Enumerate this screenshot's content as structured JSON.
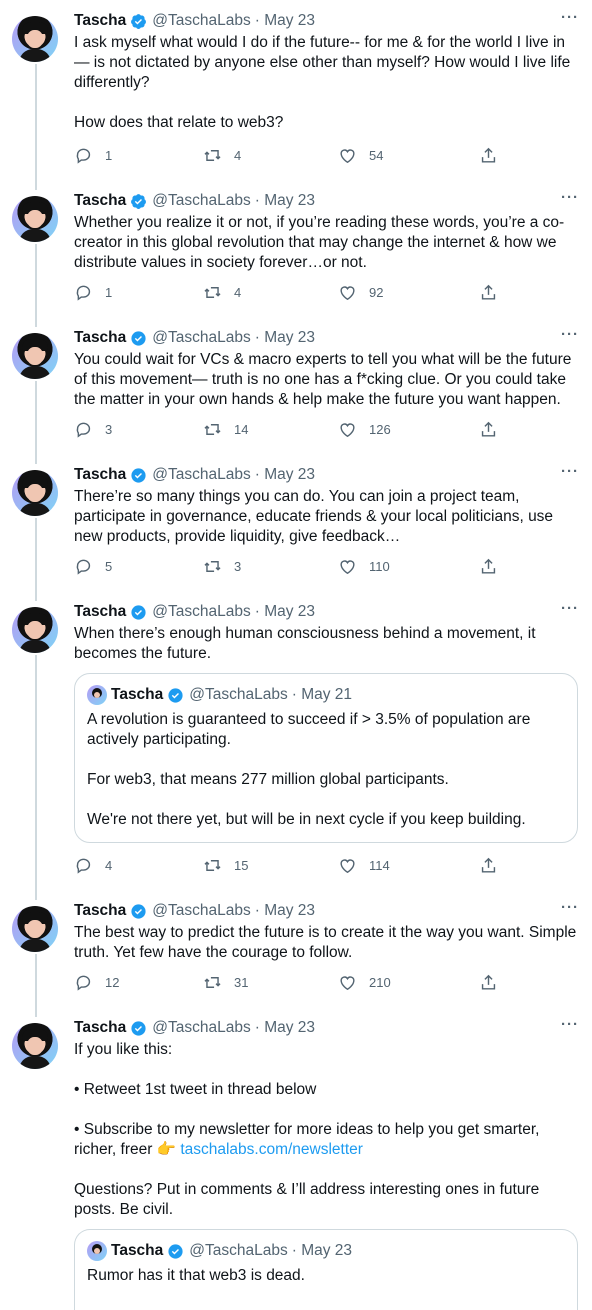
{
  "tweets": [
    {
      "name": "Tascha",
      "handle": "@TaschaLabs",
      "date": "· May 23",
      "text": "I ask myself what would I do if the future-- for me & for the world I live in— is not dictated by anyone else other than myself? How would I live life differently?\n\nHow does that relate to web3?",
      "replies": "1",
      "retweets": "4",
      "likes": "54"
    },
    {
      "name": "Tascha",
      "handle": "@TaschaLabs",
      "date": "· May 23",
      "text": "Whether you realize it or not, if you’re reading these words, you’re a co-creator in this global revolution that may change the internet & how we distribute values in society forever…or not.",
      "replies": "1",
      "retweets": "4",
      "likes": "92"
    },
    {
      "name": "Tascha",
      "handle": "@TaschaLabs",
      "date": "· May 23",
      "text": "You could wait for VCs & macro experts to tell you what will be the future of this movement— truth is no one has a f*cking clue. Or you could take the matter in your own hands & help make the future you want happen.",
      "replies": "3",
      "retweets": "14",
      "likes": "126"
    },
    {
      "name": "Tascha",
      "handle": "@TaschaLabs",
      "date": "· May 23",
      "text": "There’re so many things you can do. You can join a project team, participate in governance, educate friends & your local politicians, use new products, provide liquidity, give feedback…",
      "replies": "5",
      "retweets": "3",
      "likes": "110"
    },
    {
      "name": "Tascha",
      "handle": "@TaschaLabs",
      "date": "· May 23",
      "text": "When there’s enough human consciousness behind a movement, it becomes the future.",
      "quote": {
        "name": "Tascha",
        "handle": "@TaschaLabs",
        "date": "· May 21",
        "text": "A revolution is guaranteed to succeed if > 3.5% of population are actively participating.\n\nFor web3, that means 277 million global participants.\n\nWe're not there yet, but will be in next cycle if you keep building."
      },
      "replies": "4",
      "retweets": "15",
      "likes": "114"
    },
    {
      "name": "Tascha",
      "handle": "@TaschaLabs",
      "date": "· May 23",
      "text": "The best way to predict the future is to create it the way you want. Simple truth. Yet few have the courage to follow.",
      "replies": "12",
      "retweets": "31",
      "likes": "210"
    },
    {
      "name": "Tascha",
      "handle": "@TaschaLabs",
      "date": "· May 23",
      "text_before": "If you like this:\n\n• Retweet 1st tweet in thread below\n\n• Subscribe to my newsletter for more ideas to help you get smarter, richer, freer 👉 ",
      "link": "taschalabs.com/newsletter",
      "text_after": "\n\nQuestions? Put in comments & I’ll address interesting ones in future posts. Be civil.",
      "quote": {
        "name": "Tascha",
        "handle": "@TaschaLabs",
        "date": "· May 23",
        "text": "Rumor has it that web3 is dead."
      }
    }
  ],
  "more_label": "···",
  "colors": {
    "accent": "#1d9bf0",
    "muted": "#536471",
    "thread_line": "#cfd9de"
  },
  "icons": {
    "reply": "reply-icon",
    "retweet": "retweet-icon",
    "like": "like-icon",
    "share": "share-icon",
    "verified": "verified-badge-icon"
  }
}
